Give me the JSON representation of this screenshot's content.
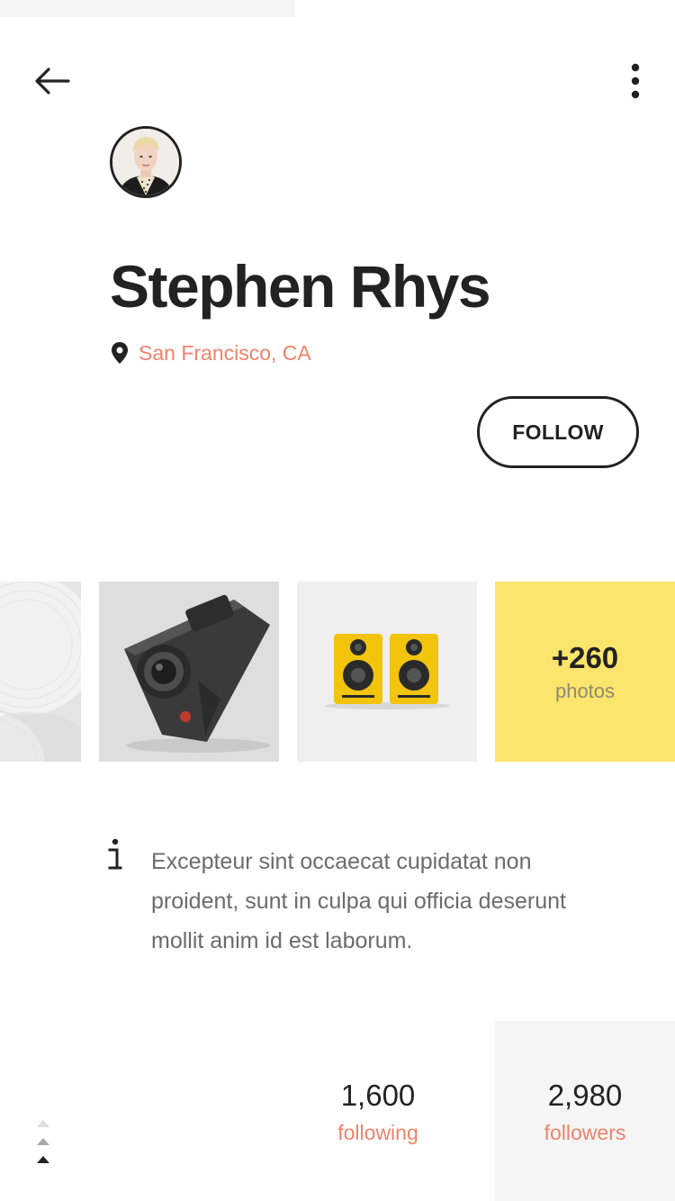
{
  "profile": {
    "name": "Stephen Rhys",
    "location": "San Francisco, CA"
  },
  "actions": {
    "follow_label": "FOLLOW"
  },
  "gallery": {
    "more_count": "+260",
    "more_label": "photos"
  },
  "bio": {
    "text": "Excepteur sint occaecat cupidatat non proident, sunt in culpa qui officia deserunt mollit anim id est laborum."
  },
  "stats": {
    "following_value": "1,600",
    "following_label": "following",
    "followers_value": "2,980",
    "followers_label": "followers"
  },
  "icons": {
    "back": "arrow-left-icon",
    "more": "more-vertical-icon",
    "location": "map-pin-icon",
    "info": "info-icon",
    "scroll": "scroll-up-indicator-icon"
  },
  "colors": {
    "accent": "#f0826a",
    "highlight": "#fbe56c",
    "text_primary": "#222222",
    "text_secondary": "#6b6b6b"
  }
}
